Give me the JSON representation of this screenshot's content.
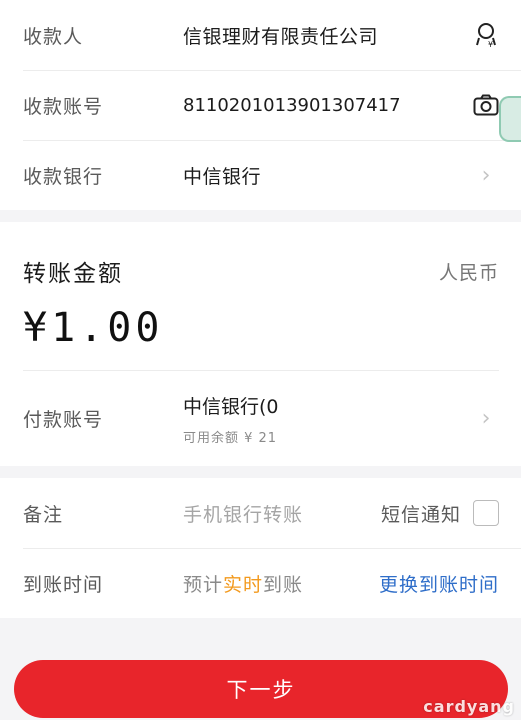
{
  "payee": {
    "name_label": "收款人",
    "name_value": "信银理财有限责任公司",
    "account_label": "收款账号",
    "account_value": "8110201013901307417",
    "bank_label": "收款银行",
    "bank_value": "中信银行"
  },
  "amount": {
    "title": "转账金额",
    "currency": "人民币",
    "value": "¥1.00"
  },
  "payer": {
    "label": "付款账号",
    "bank": "中信银行(0",
    "balance": "可用余额 ¥ 21"
  },
  "memo": {
    "label": "备注",
    "placeholder": "手机银行转账",
    "sms_label": "短信通知"
  },
  "arrival": {
    "label": "到账时间",
    "prefix": "预计",
    "highlight": "实时",
    "suffix": "到账",
    "change_link": "更换到账时间"
  },
  "next_button": "下一步",
  "watermark": "cardyang",
  "colors": {
    "accent_red": "#e8252b",
    "link_blue": "#2f6ec9",
    "highlight_orange": "#f39a1e"
  }
}
